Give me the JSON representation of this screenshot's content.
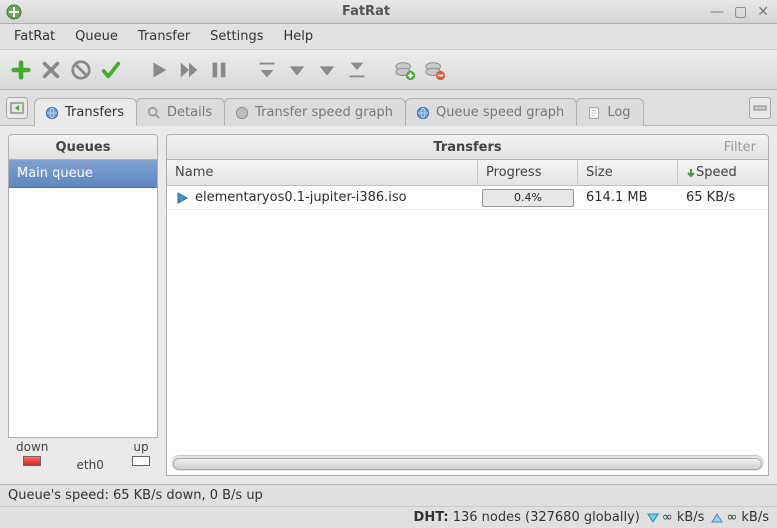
{
  "window": {
    "title": "FatRat"
  },
  "menubar": [
    "FatRat",
    "Queue",
    "Transfer",
    "Settings",
    "Help"
  ],
  "tabs": [
    {
      "label": "Transfers",
      "active": true
    },
    {
      "label": "Details",
      "active": false
    },
    {
      "label": "Transfer speed graph",
      "active": false
    },
    {
      "label": "Queue speed graph",
      "active": false
    },
    {
      "label": "Log",
      "active": false
    }
  ],
  "queues": {
    "header": "Queues",
    "items": [
      "Main queue"
    ],
    "footer": {
      "down": "down",
      "up": "up",
      "iface": "eth0"
    }
  },
  "transfers": {
    "header_title": "Transfers",
    "filter_placeholder": "Filter",
    "columns": {
      "name": "Name",
      "progress": "Progress",
      "size": "Size",
      "speed": "Speed"
    },
    "rows": [
      {
        "name": "elementaryos0.1-jupiter-i386.iso",
        "progress_pct": 0.4,
        "progress_label": "0.4%",
        "size": "614.1 MB",
        "speed": "65 KB/s"
      }
    ]
  },
  "statusbar1": {
    "queue_speed": "Queue's speed: 65 KB/s down, 0 B/s up"
  },
  "statusbar2": {
    "dht_label": "DHT:",
    "dht_value": "136 nodes (327680 globally)",
    "down_rate": "∞ kB/s",
    "up_rate": "∞ kB/s"
  },
  "colors": {
    "accent": "#5f88bf"
  }
}
